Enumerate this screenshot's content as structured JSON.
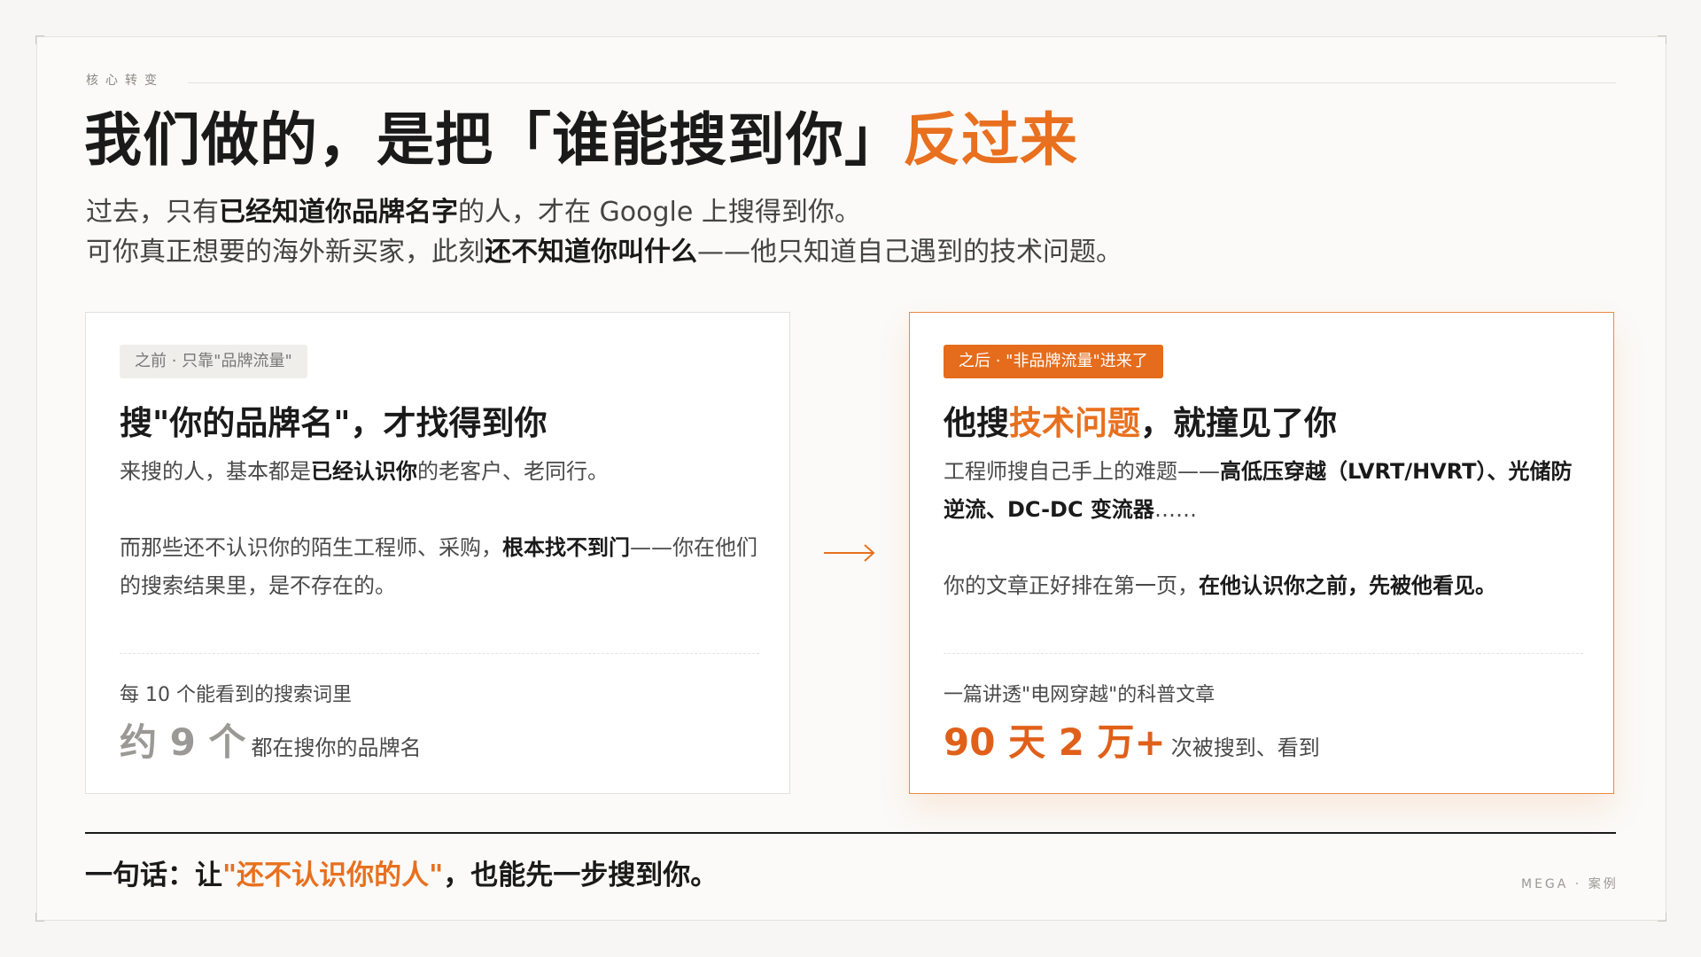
{
  "kicker": "核心转变",
  "title": {
    "part1": "我们做的，是把「谁能搜到你」",
    "accent": "反过来"
  },
  "intro": {
    "line1": {
      "a": "过去，只有",
      "b": "已经知道你品牌名字",
      "c": "的人，才在 Google 上搜得到你。"
    },
    "line2": {
      "a": "可你真正想要的海外新买家，此刻",
      "b": "还不知道你叫什么",
      "c": "——他只知道自己遇到的技术问题。"
    }
  },
  "before": {
    "tag": "之前 · 只靠\"品牌流量\"",
    "title": "搜\"你的品牌名\"，才找得到你",
    "p1": {
      "a": "来搜的人，基本都是",
      "b": "已经认识你",
      "c": "的老客户、老同行。"
    },
    "p2": {
      "a": "而那些还不认识你的陌生工程师、采购，",
      "b": "根本找不到门",
      "c": "——你在他们的搜索结果里，是不存在的。"
    },
    "stat_label": "每 10 个能看到的搜索词里",
    "stat_value": "约 9 个",
    "stat_suffix": "都在搜你的品牌名"
  },
  "after": {
    "tag": "之后 · \"非品牌流量\"进来了",
    "title": {
      "a": "他搜",
      "accent": "技术问题",
      "b": "，就撞见了你"
    },
    "p1": {
      "a": "工程师搜自己手上的难题——",
      "b": "高低压穿越（LVRT/HVRT）、光储防逆流、DC-DC 变流器",
      "c": "……"
    },
    "p2": {
      "a": "你的文章正好排在第一页，",
      "b": "在他认识你之前，先被他看见。"
    },
    "stat_label": "一篇讲透\"电网穿越\"的科普文章",
    "stat_value": "90 天 2 万+",
    "stat_suffix": "次被搜到、看到"
  },
  "summary": {
    "a": "一句话：让",
    "accent": "\"还不认识你的人\"",
    "b": "，也能先一步搜到你。"
  },
  "footer": "MEGA · 案例",
  "colors": {
    "accent": "#e8701f",
    "accent_dark": "#e0601a",
    "text": "#1a1a1a"
  },
  "icons": {
    "transition": "arrow-right-icon"
  }
}
